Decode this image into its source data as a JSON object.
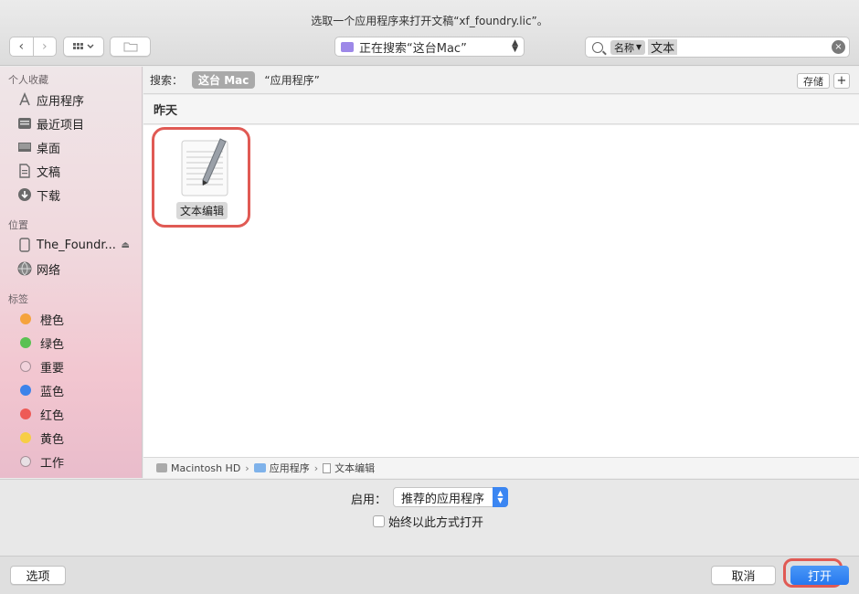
{
  "window": {
    "title": "选取一个应用程序来打开文稿“xf_foundry.lic”。"
  },
  "toolbar": {
    "back_icon": "‹",
    "forward_icon": "›",
    "view_icon": "grid-view-icon",
    "location": "正在搜索“这台Mac”",
    "search_token": "名称",
    "search_value": "文本",
    "clear_icon": "×"
  },
  "sidebar": {
    "favorites_title": "个人收藏",
    "favorites": [
      {
        "label": "应用程序",
        "icon": "A"
      },
      {
        "label": "最近项目",
        "icon": "▤"
      },
      {
        "label": "桌面",
        "icon": "▭"
      },
      {
        "label": "文稿",
        "icon": "▯"
      },
      {
        "label": "下载",
        "icon": "⬇"
      }
    ],
    "locations_title": "位置",
    "locations": [
      {
        "label": "The_Foundr...",
        "eject": "⏏"
      },
      {
        "label": "网络"
      }
    ],
    "tags_title": "标签",
    "tags": [
      {
        "label": "橙色",
        "color": "#f5a33d"
      },
      {
        "label": "绿色",
        "color": "#5ac152"
      },
      {
        "label": "重要",
        "color": "#f2d3dc"
      },
      {
        "label": "蓝色",
        "color": "#3c83ea"
      },
      {
        "label": "红色",
        "color": "#ee5a56"
      },
      {
        "label": "黄色",
        "color": "#f7ce45"
      },
      {
        "label": "工作",
        "color": "#e8e0e4"
      }
    ]
  },
  "scope": {
    "label": "搜索：",
    "active": "这台 Mac",
    "other": "“应用程序”",
    "save": "存储",
    "add": "+"
  },
  "results": {
    "group_header": "昨天",
    "items": [
      {
        "label": "文本编辑"
      }
    ]
  },
  "path": [
    {
      "label": "Macintosh HD"
    },
    {
      "label": "应用程序"
    },
    {
      "label": "文本编辑"
    }
  ],
  "accessory": {
    "enable_label": "启用：",
    "enable_value": "推荐的应用程序",
    "always_label": "始终以此方式打开"
  },
  "footer": {
    "options": "选项",
    "cancel": "取消",
    "open": "打开"
  }
}
